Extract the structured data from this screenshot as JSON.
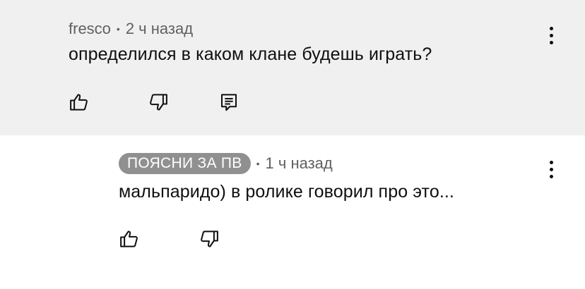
{
  "comments": [
    {
      "author": "fresco",
      "time": "2 ч назад",
      "text": "определился в каком клане будешь играть?"
    },
    {
      "author": "ПОЯСНИ ЗА ПВ",
      "time": "1 ч назад",
      "text": "мальпаридо) в ролике говорил про это..."
    }
  ],
  "separator": "•",
  "icons": {
    "like": "thumbs-up-icon",
    "dislike": "thumbs-down-icon",
    "reply": "reply-comment-icon",
    "menu": "more-vertical-icon"
  },
  "colors": {
    "highlight_background": "#f0f0f0",
    "badge_background": "#909090",
    "meta_text": "#606060",
    "text": "#0f0f0f"
  }
}
